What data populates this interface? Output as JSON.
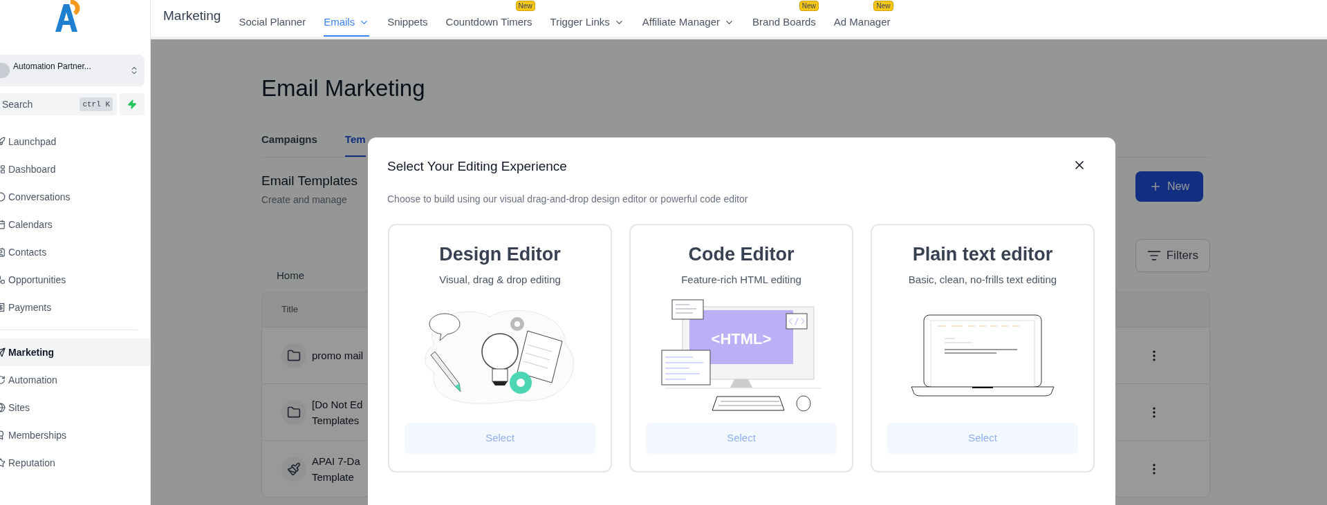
{
  "sidebar": {
    "account": {
      "name": "Automation Partner..."
    },
    "search": {
      "placeholder": "Search",
      "shortcut": "ctrl K"
    },
    "sections": [
      {
        "items": [
          {
            "label": "Launchpad",
            "selected": false
          },
          {
            "label": "Dashboard",
            "selected": false
          },
          {
            "label": "Conversations",
            "selected": false
          },
          {
            "label": "Calendars",
            "selected": false
          },
          {
            "label": "Contacts",
            "selected": false
          },
          {
            "label": "Opportunities",
            "selected": false
          },
          {
            "label": "Payments",
            "selected": false
          }
        ]
      },
      {
        "items": [
          {
            "label": "Marketing",
            "selected": true
          },
          {
            "label": "Automation",
            "selected": false
          },
          {
            "label": "Sites",
            "selected": false
          },
          {
            "label": "Memberships",
            "selected": false
          },
          {
            "label": "Reputation",
            "selected": false
          }
        ]
      }
    ]
  },
  "topnav": {
    "title": "Marketing",
    "items": [
      {
        "label": "Social Planner",
        "selected": false,
        "dropdown": false
      },
      {
        "label": "Emails",
        "selected": true,
        "dropdown": true
      },
      {
        "label": "Snippets",
        "selected": false,
        "dropdown": false
      },
      {
        "label": "Countdown Timers",
        "selected": false,
        "dropdown": false,
        "badge": "New"
      },
      {
        "label": "Trigger Links",
        "selected": false,
        "dropdown": true
      },
      {
        "label": "Affiliate Manager",
        "selected": false,
        "dropdown": true
      },
      {
        "label": "Brand Boards",
        "selected": false,
        "dropdown": false,
        "badge": "New"
      },
      {
        "label": "Ad Manager",
        "selected": false,
        "dropdown": false,
        "badge": "New"
      }
    ]
  },
  "page": {
    "title": "Email Marketing",
    "tabs": [
      {
        "label": "Campaigns",
        "selected": false
      },
      {
        "label": "Tem",
        "selected": true
      }
    ],
    "section_title": "Email Templates",
    "section_subtitle": "Create and manage",
    "new_button": "New",
    "filters_button": "Filters",
    "breadcrumb": "Home",
    "table": {
      "columns": [
        "Title"
      ],
      "rows": [
        {
          "kind": "folder",
          "lines": [
            "promo mail"
          ]
        },
        {
          "kind": "folder",
          "lines": [
            "[Do Not Ed",
            "Templates"
          ]
        },
        {
          "kind": "template",
          "lines": [
            "APAI 7-Da",
            "Template"
          ]
        }
      ]
    }
  },
  "modal": {
    "title": "Select Your Editing Experience",
    "subtitle": "Choose to build using our visual drag-and-drop design editor or powerful code editor",
    "cards": [
      {
        "kind": "design",
        "title": "Design Editor",
        "subtitle": "Visual, drag & drop editing",
        "button": "Select"
      },
      {
        "kind": "code",
        "title": "Code Editor",
        "subtitle": "Feature-rich HTML editing",
        "button": "Select",
        "screen_label": "<HTML>"
      },
      {
        "kind": "plain",
        "title": "Plain text editor",
        "subtitle": "Basic, clean, no-frills text editing",
        "button": "Select"
      }
    ]
  }
}
